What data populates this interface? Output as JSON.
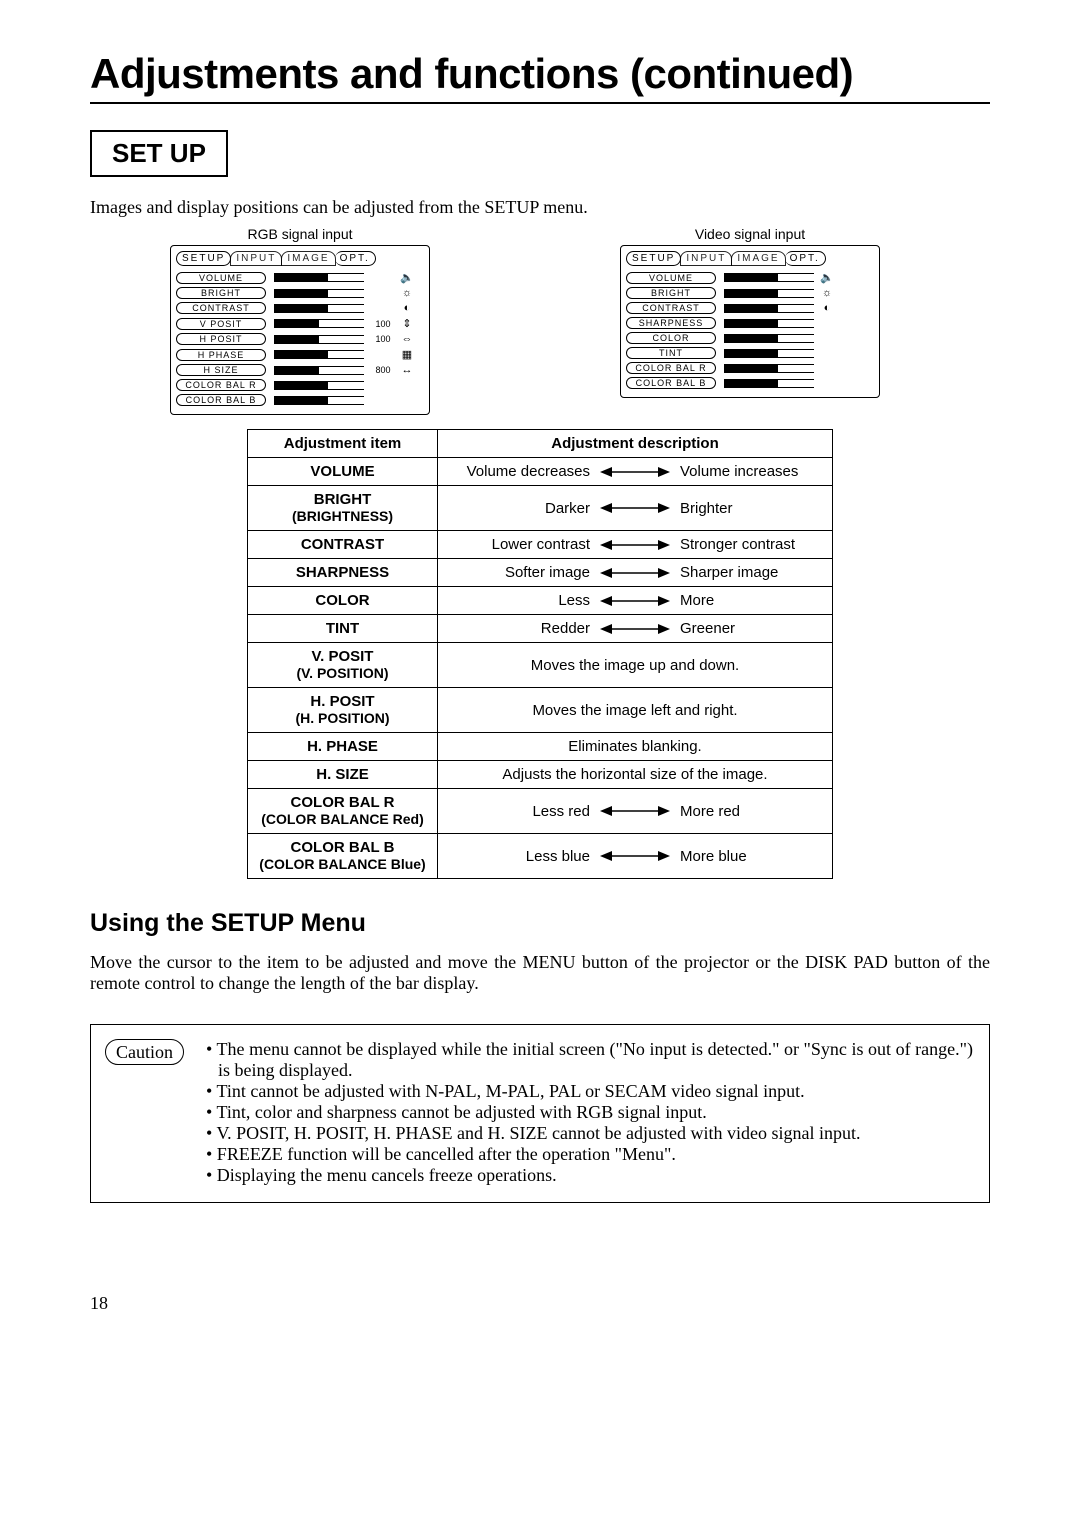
{
  "title": "Adjustments and functions (continued)",
  "setup_label": "SET UP",
  "intro": "Images and display positions can be adjusted from the SETUP menu.",
  "osd": {
    "rgb_caption": "RGB signal input",
    "video_caption": "Video signal input",
    "tabs": [
      "SETUP",
      "INPUT",
      "IMAGE",
      "OPT."
    ],
    "rgb_items": [
      {
        "label": "VOLUME",
        "fill": 60,
        "value": "",
        "icon": "🔈"
      },
      {
        "label": "BRIGHT",
        "fill": 60,
        "value": "",
        "icon": "☼"
      },
      {
        "label": "CONTRAST",
        "fill": 60,
        "value": "",
        "icon": "◐"
      },
      {
        "label": "V POSIT",
        "fill": 50,
        "value": "100",
        "icon": "⇕"
      },
      {
        "label": "H POSIT",
        "fill": 50,
        "value": "100",
        "icon": "⇔"
      },
      {
        "label": "H PHASE",
        "fill": 60,
        "value": "",
        "icon": "▦"
      },
      {
        "label": "H SIZE",
        "fill": 50,
        "value": "800",
        "icon": "↔"
      },
      {
        "label": "COLOR BAL R",
        "fill": 60,
        "value": "",
        "icon": ""
      },
      {
        "label": "COLOR BAL B",
        "fill": 60,
        "value": "",
        "icon": ""
      }
    ],
    "video_items": [
      {
        "label": "VOLUME",
        "fill": 60,
        "icon": "🔈"
      },
      {
        "label": "BRIGHT",
        "fill": 60,
        "icon": "☼"
      },
      {
        "label": "CONTRAST",
        "fill": 60,
        "icon": "◐"
      },
      {
        "label": "SHARPNESS",
        "fill": 60,
        "icon": ""
      },
      {
        "label": "COLOR",
        "fill": 60,
        "icon": ""
      },
      {
        "label": "TINT",
        "fill": 60,
        "icon": ""
      },
      {
        "label": "COLOR BAL R",
        "fill": 60,
        "icon": ""
      },
      {
        "label": "COLOR BAL B",
        "fill": 60,
        "icon": ""
      }
    ]
  },
  "adj_table": {
    "head_item": "Adjustment item",
    "head_desc": "Adjustment description",
    "rows": [
      {
        "item": "VOLUME",
        "sub": "",
        "type": "arrow",
        "left": "Volume decreases",
        "right": "Volume increases"
      },
      {
        "item": "BRIGHT",
        "sub": "(BRIGHTNESS)",
        "type": "arrow",
        "left": "Darker",
        "right": "Brighter"
      },
      {
        "item": "CONTRAST",
        "sub": "",
        "type": "arrow",
        "left": "Lower contrast",
        "right": "Stronger contrast"
      },
      {
        "item": "SHARPNESS",
        "sub": "",
        "type": "arrow",
        "left": "Softer image",
        "right": "Sharper image"
      },
      {
        "item": "COLOR",
        "sub": "",
        "type": "arrow",
        "left": "Less",
        "right": "More"
      },
      {
        "item": "TINT",
        "sub": "",
        "type": "arrow",
        "left": "Redder",
        "right": "Greener"
      },
      {
        "item": "V. POSIT",
        "sub": "(V. POSITION)",
        "type": "text",
        "text": "Moves the image up and down."
      },
      {
        "item": "H. POSIT",
        "sub": "(H. POSITION)",
        "type": "text",
        "text": "Moves the image left and right."
      },
      {
        "item": "H. PHASE",
        "sub": "",
        "type": "text",
        "text": "Eliminates blanking."
      },
      {
        "item": "H. SIZE",
        "sub": "",
        "type": "text",
        "text": "Adjusts the horizontal size of the image."
      },
      {
        "item": "COLOR BAL R",
        "sub": "(COLOR BALANCE Red)",
        "type": "arrow",
        "left": "Less  red",
        "right": "More  red"
      },
      {
        "item": "COLOR BAL B",
        "sub": "(COLOR BALANCE Blue)",
        "type": "arrow",
        "left": "Less  blue",
        "right": "More blue"
      }
    ]
  },
  "subhead": "Using the SETUP Menu",
  "body": "Move the cursor to the item to be adjusted and move the MENU button of the projector or the DISK PAD button of the remote control to change the length of the bar display.",
  "caution_label": "Caution",
  "caution": [
    "• The menu cannot be displayed while the initial screen (\"No input is detected.\" or \"Sync is out of range.\") is being displayed.",
    "• Tint cannot be adjusted with N-PAL, M-PAL, PAL or SECAM video signal input.",
    "• Tint, color and sharpness cannot be adjusted with RGB signal input.",
    "• V. POSIT, H. POSIT, H. PHASE and H. SIZE cannot be adjusted with video signal input.",
    "• FREEZE function will be cancelled after the operation \"Menu\".",
    "• Displaying the menu cancels freeze operations."
  ],
  "pagenum": "18"
}
